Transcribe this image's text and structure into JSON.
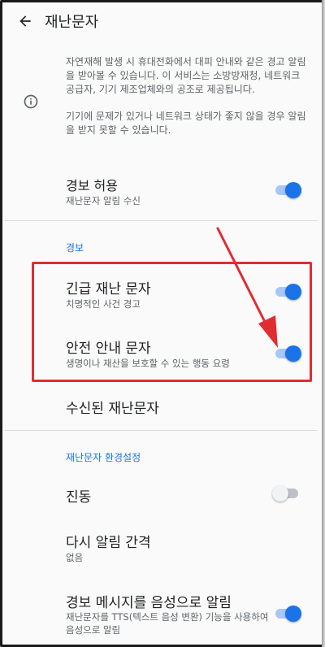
{
  "appbar": {
    "title": "재난문자"
  },
  "info": {
    "paragraph1": "자연재해 발생 시 휴대전화에서 대피 안내와 같은 경고 알림을 받아볼 수 있습니다. 이 서비스는 소방방재청, 네트워크 공급자, 기기 제조업체와의 공조로 제공됩니다.",
    "paragraph2": "기기에 문제가 있거나 네트워크 상태가 좋지 않을 경우 알림을 받지 못할 수 있습니다."
  },
  "alert_allow": {
    "label": "경보 허용",
    "summary": "재난문자 알림 수신",
    "enabled": true
  },
  "section_alerts": {
    "header": "경보"
  },
  "emergency_alert": {
    "label": "긴급 재난 문자",
    "summary": "치명적인 사건 경고",
    "enabled": true
  },
  "safety_alert": {
    "label": "안전 안내 문자",
    "summary": "생명이나 재산을 보호할 수 있는 행동 요령",
    "enabled": true
  },
  "received_messages": {
    "label": "수신된 재난문자"
  },
  "section_settings": {
    "header": "재난문자 환경설정"
  },
  "vibration": {
    "label": "진동",
    "enabled": false
  },
  "reminder": {
    "label": "다시 알림 간격",
    "summary": "없음"
  },
  "speak_alert": {
    "label": "경보 메시지를 음성으로 알림",
    "summary": "재난문자를 TTS(텍스트 음성 변환) 기능을 사용하여 음성으로 알림",
    "enabled": true
  },
  "colors": {
    "accent": "#1a73e8",
    "annotation": "#e02d32"
  }
}
